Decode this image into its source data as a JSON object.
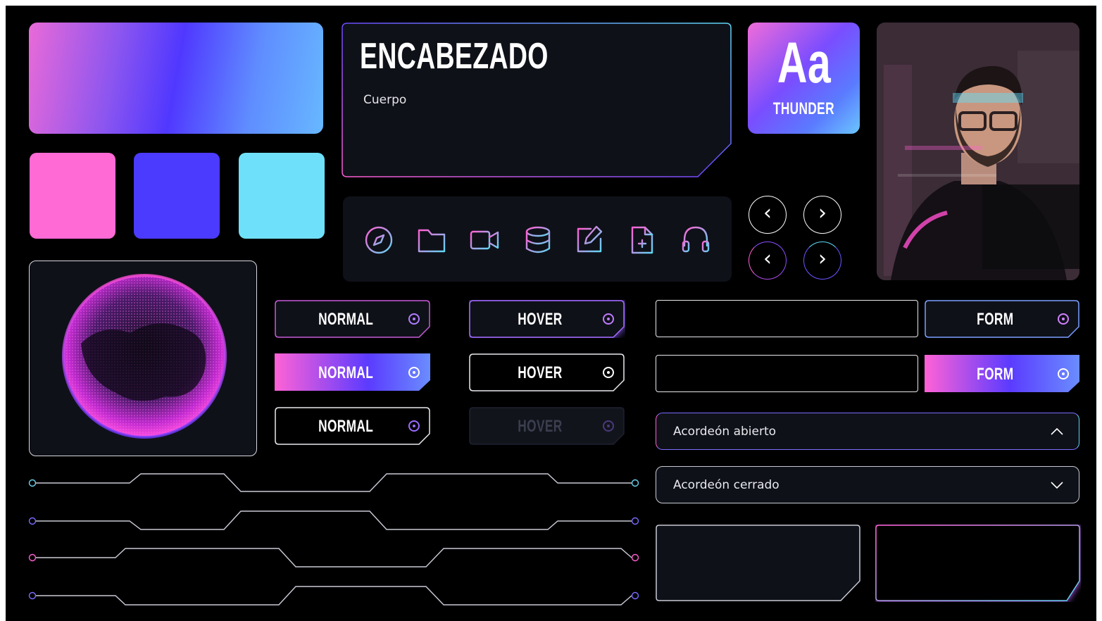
{
  "heading": {
    "title": "ENCABEZADO",
    "body": "Cuerpo"
  },
  "font_card": {
    "sample": "Aa",
    "name": "THUNDER"
  },
  "palette": {
    "gradient": [
      "#ff6ad5",
      "#5b3bff",
      "#6cc8ff"
    ],
    "swatches": [
      "#ff6ad5",
      "#4b3bff",
      "#6fe0fa"
    ]
  },
  "toolbar": {
    "icons": [
      "compass-icon",
      "folder-icon",
      "video-icon",
      "database-icon",
      "edit-icon",
      "file-plus-icon",
      "headphones-icon"
    ]
  },
  "nav": {
    "prev_symbol": "‹",
    "next_symbol": "›"
  },
  "buttons": {
    "normal": [
      "NORMAL",
      "NORMAL",
      "NORMAL"
    ],
    "hover": [
      "HOVER",
      "HOVER",
      "HOVER"
    ]
  },
  "form": {
    "button_label": "FORM",
    "button_label_active": "FORM",
    "input1_value": "",
    "input2_value": ""
  },
  "accordion": {
    "open_label": "Acordeón abierto",
    "closed_label": "Acordeón cerrado"
  },
  "colors": {
    "pink": "#ff5fd2",
    "purple": "#5b3bff",
    "cyan": "#5fd8f5",
    "panel": "#0f1119"
  }
}
